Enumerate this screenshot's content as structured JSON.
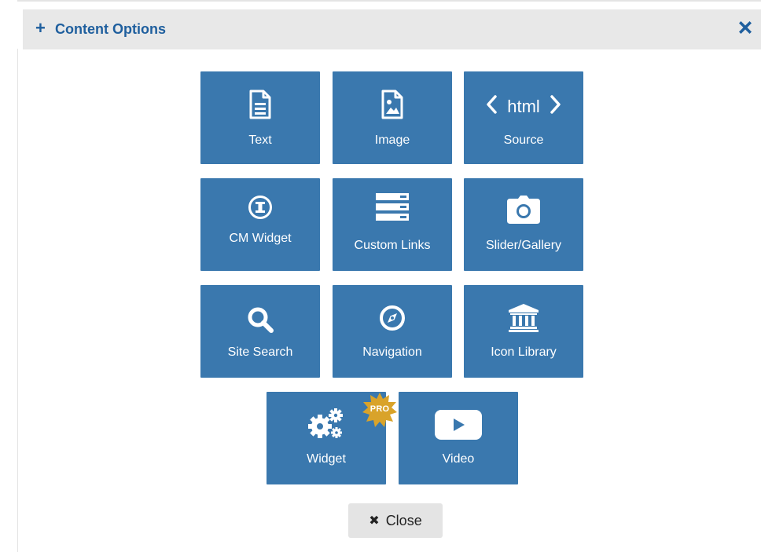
{
  "dialog": {
    "title": "Content Options",
    "plus_glyph": "+",
    "close_icon": "close-icon",
    "accent_color": "#1f5f9e"
  },
  "tiles": [
    {
      "label": "Text",
      "icon": "document-icon"
    },
    {
      "label": "Image",
      "icon": "image-file-icon"
    },
    {
      "label": "Source",
      "icon": "code-icon",
      "icon_text": "html"
    },
    {
      "label": "CM Widget",
      "icon": "cm-widget-icon"
    },
    {
      "label": "Custom Links",
      "icon": "links-list-icon"
    },
    {
      "label": "Slider/Gallery",
      "icon": "camera-icon"
    },
    {
      "label": "Site Search",
      "icon": "search-icon"
    },
    {
      "label": "Navigation",
      "icon": "compass-icon"
    },
    {
      "label": "Icon Library",
      "icon": "institution-icon"
    },
    {
      "label": "Widget",
      "icon": "gears-icon",
      "badge": "PRO"
    },
    {
      "label": "Video",
      "icon": "play-icon"
    }
  ],
  "tile_color": "#3a78ae",
  "badge_color": "#d9a32a",
  "footer": {
    "close_glyph": "✖",
    "close_label": "Close"
  }
}
